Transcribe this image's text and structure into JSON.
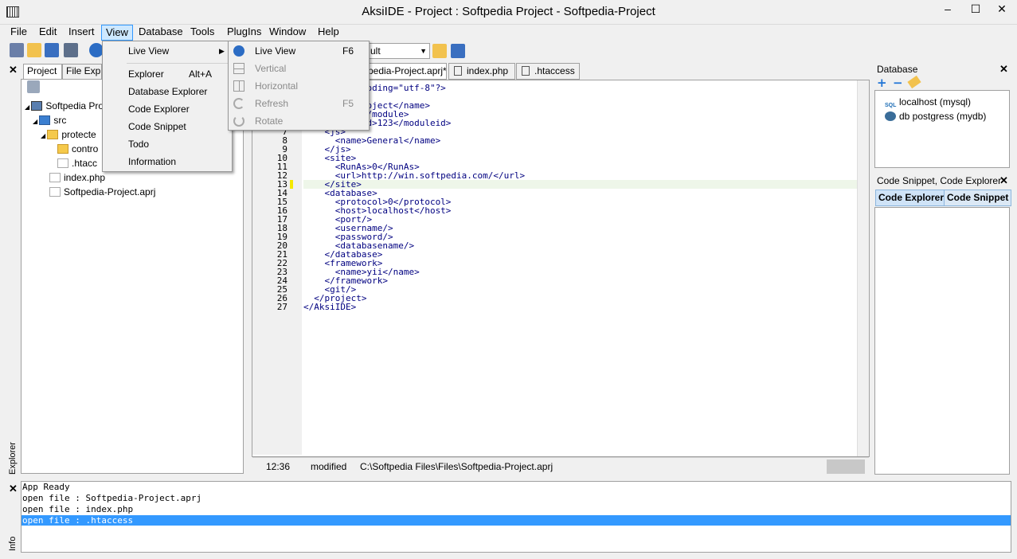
{
  "window": {
    "title": "AksiIDE - Project : Softpedia Project - Softpedia-Project",
    "minimize": "–",
    "maximize": "☐",
    "close": "✕"
  },
  "menubar": [
    "File",
    "Edit",
    "Insert",
    "View",
    "Database",
    "Tools",
    "PlugIns",
    "Window",
    "Help"
  ],
  "toolbar": {
    "profile_dropdown": "ult"
  },
  "left_panel": {
    "side_label": "Explorer",
    "tabs": [
      "Project",
      "File Explo"
    ],
    "tree": [
      {
        "label": "Softpedia Proj",
        "icon": "project-icon"
      },
      {
        "label": "src",
        "icon": "src-folder-icon"
      },
      {
        "label": "protecte",
        "icon": "folder-icon"
      },
      {
        "label": "contro",
        "icon": "folder-icon"
      },
      {
        "label": ".htacc",
        "icon": "file-icon"
      },
      {
        "label": "index.php",
        "icon": "file-icon"
      },
      {
        "label": "Softpedia-Project.aprj",
        "icon": "file-icon"
      }
    ]
  },
  "editor": {
    "tabs": [
      "pedia-Project.aprj*",
      "index.php",
      ".htaccess"
    ],
    "lines": [
      {
        "n": "",
        "t": "on=\"1.0\" encoding=\"utf-8\"?>"
      },
      {
        "n": "",
        "t": ""
      },
      {
        "n": "",
        "t": "Softpedia Project</name>"
      },
      {
        "n": "",
        "t": "e>Softpedia</module>"
      },
      {
        "n": "6",
        "t": "    <moduleid>123</moduleid>"
      },
      {
        "n": "7",
        "t": "    <js>"
      },
      {
        "n": "8",
        "t": "      <name>General</name>"
      },
      {
        "n": "9",
        "t": "    </js>"
      },
      {
        "n": "10",
        "t": "    <site>"
      },
      {
        "n": "11",
        "t": "      <RunAs>0</RunAs>"
      },
      {
        "n": "12",
        "t": "      <url>http://win.softpedia.com/</url>"
      },
      {
        "n": "13",
        "t": "    </site>"
      },
      {
        "n": "14",
        "t": "    <database>"
      },
      {
        "n": "15",
        "t": "      <protocol>0</protocol>"
      },
      {
        "n": "16",
        "t": "      <host>localhost</host>"
      },
      {
        "n": "17",
        "t": "      <port/>"
      },
      {
        "n": "18",
        "t": "      <username/>"
      },
      {
        "n": "19",
        "t": "      <password/>"
      },
      {
        "n": "20",
        "t": "      <databasename/>"
      },
      {
        "n": "21",
        "t": "    </database>"
      },
      {
        "n": "22",
        "t": "    <framework>"
      },
      {
        "n": "23",
        "t": "      <name>yii</name>"
      },
      {
        "n": "24",
        "t": "    </framework>"
      },
      {
        "n": "25",
        "t": "    <git/>"
      },
      {
        "n": "26",
        "t": "  </project>"
      },
      {
        "n": "27",
        "t": "</AksiIDE>"
      }
    ],
    "status": {
      "position": "12:36",
      "state": "modified",
      "path": "C:\\Softpedia Files\\Files\\Softpedia-Project.aprj"
    }
  },
  "database_panel": {
    "title": "Database",
    "connections": [
      {
        "label": "localhost (mysql)",
        "icon": "mysql-icon"
      },
      {
        "label": "db postgress (mydb)",
        "icon": "postgres-icon"
      }
    ]
  },
  "code_panel": {
    "title": "Code Snippet, Code Explorer",
    "tabs": [
      "Code Explorer",
      "Code Snippet"
    ]
  },
  "info_panel": {
    "side_label": "Info",
    "log": [
      "App Ready",
      "open file : Softpedia-Project.aprj",
      "open file : index.php",
      "open file : .htaccess"
    ]
  },
  "view_menu": {
    "items": [
      {
        "label": "Live View",
        "shortcut": "",
        "submenu": true
      },
      {
        "label": "Explorer",
        "shortcut": "Alt+A"
      },
      {
        "label": "Database Explorer",
        "shortcut": ""
      },
      {
        "label": "Code Explorer",
        "shortcut": ""
      },
      {
        "label": "Code Snippet",
        "shortcut": ""
      },
      {
        "label": "Todo",
        "shortcut": ""
      },
      {
        "label": "Information",
        "shortcut": ""
      }
    ]
  },
  "live_view_submenu": {
    "items": [
      {
        "label": "Live View",
        "shortcut": "F6",
        "enabled": true
      },
      {
        "label": "Vertical",
        "shortcut": "",
        "enabled": false
      },
      {
        "label": "Horizontal",
        "shortcut": "",
        "enabled": false
      },
      {
        "label": "Refresh",
        "shortcut": "F5",
        "enabled": false
      },
      {
        "label": "Rotate",
        "shortcut": "",
        "enabled": false
      }
    ]
  },
  "colors": {
    "selection": "#3399ff",
    "menu_highlight": "#cde8ff",
    "tag": "#000080",
    "current_line": "#eef6e9"
  }
}
